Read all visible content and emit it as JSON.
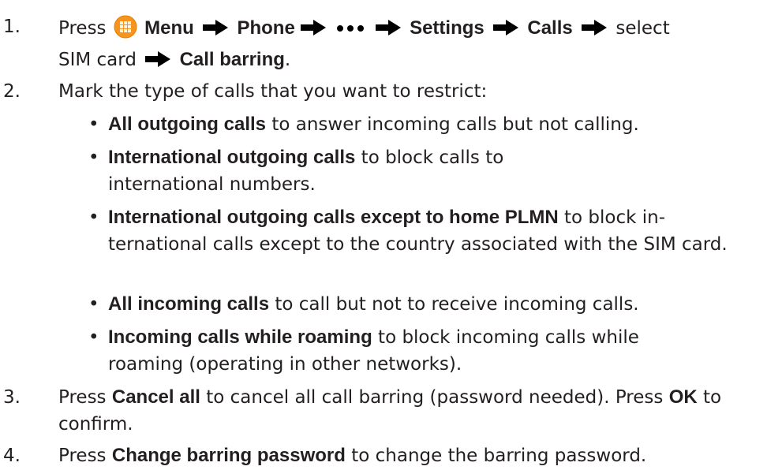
{
  "steps": [
    {
      "number": "1.",
      "press": "Press",
      "menu": "Menu",
      "phone": "Phone",
      "settings": "Settings",
      "calls": "Calls",
      "select": "select",
      "sim": "SIM card",
      "call_barring": "Call barring",
      "end": "."
    },
    {
      "number": "2.",
      "text": "Mark the type of calls that you want to restrict:"
    },
    {
      "number": "3.",
      "press": "Press",
      "cancel_all": "Cancel all",
      "middle": " to cancel all call barring (password needed). Press ",
      "ok": "OK",
      "end": " to confirm."
    },
    {
      "number": "4.",
      "press": "Press",
      "change_pw": "Change barring password",
      "end": " to change the barring password."
    }
  ],
  "bullets": [
    {
      "marker": "•",
      "bold": "All outgoing calls",
      "rest": " to answer incoming calls but not calling."
    },
    {
      "marker": "•",
      "bold": "International outgoing calls",
      "rest": " to block calls to international numbers."
    },
    {
      "marker": "•",
      "bold": "International outgoing calls except to home PLMN",
      "rest": " to block in-ternational calls except to the country associated with the SIM card."
    },
    {
      "marker": "•",
      "bold": "All incoming calls",
      "rest": " to call but not to receive incoming calls."
    },
    {
      "marker": "•",
      "bold": "Incoming calls while roaming",
      "rest": " to block incoming calls while roaming (operating in other networks)."
    }
  ],
  "icons": {
    "menu_icon": "menu-grid-icon",
    "arrow_icon": "right-arrow-icon",
    "more_icon": "more-dots-icon"
  },
  "colors": {
    "menu_icon_fill": "#f7941d",
    "menu_icon_inner": "#fdd9a0",
    "text": "#231f20"
  }
}
